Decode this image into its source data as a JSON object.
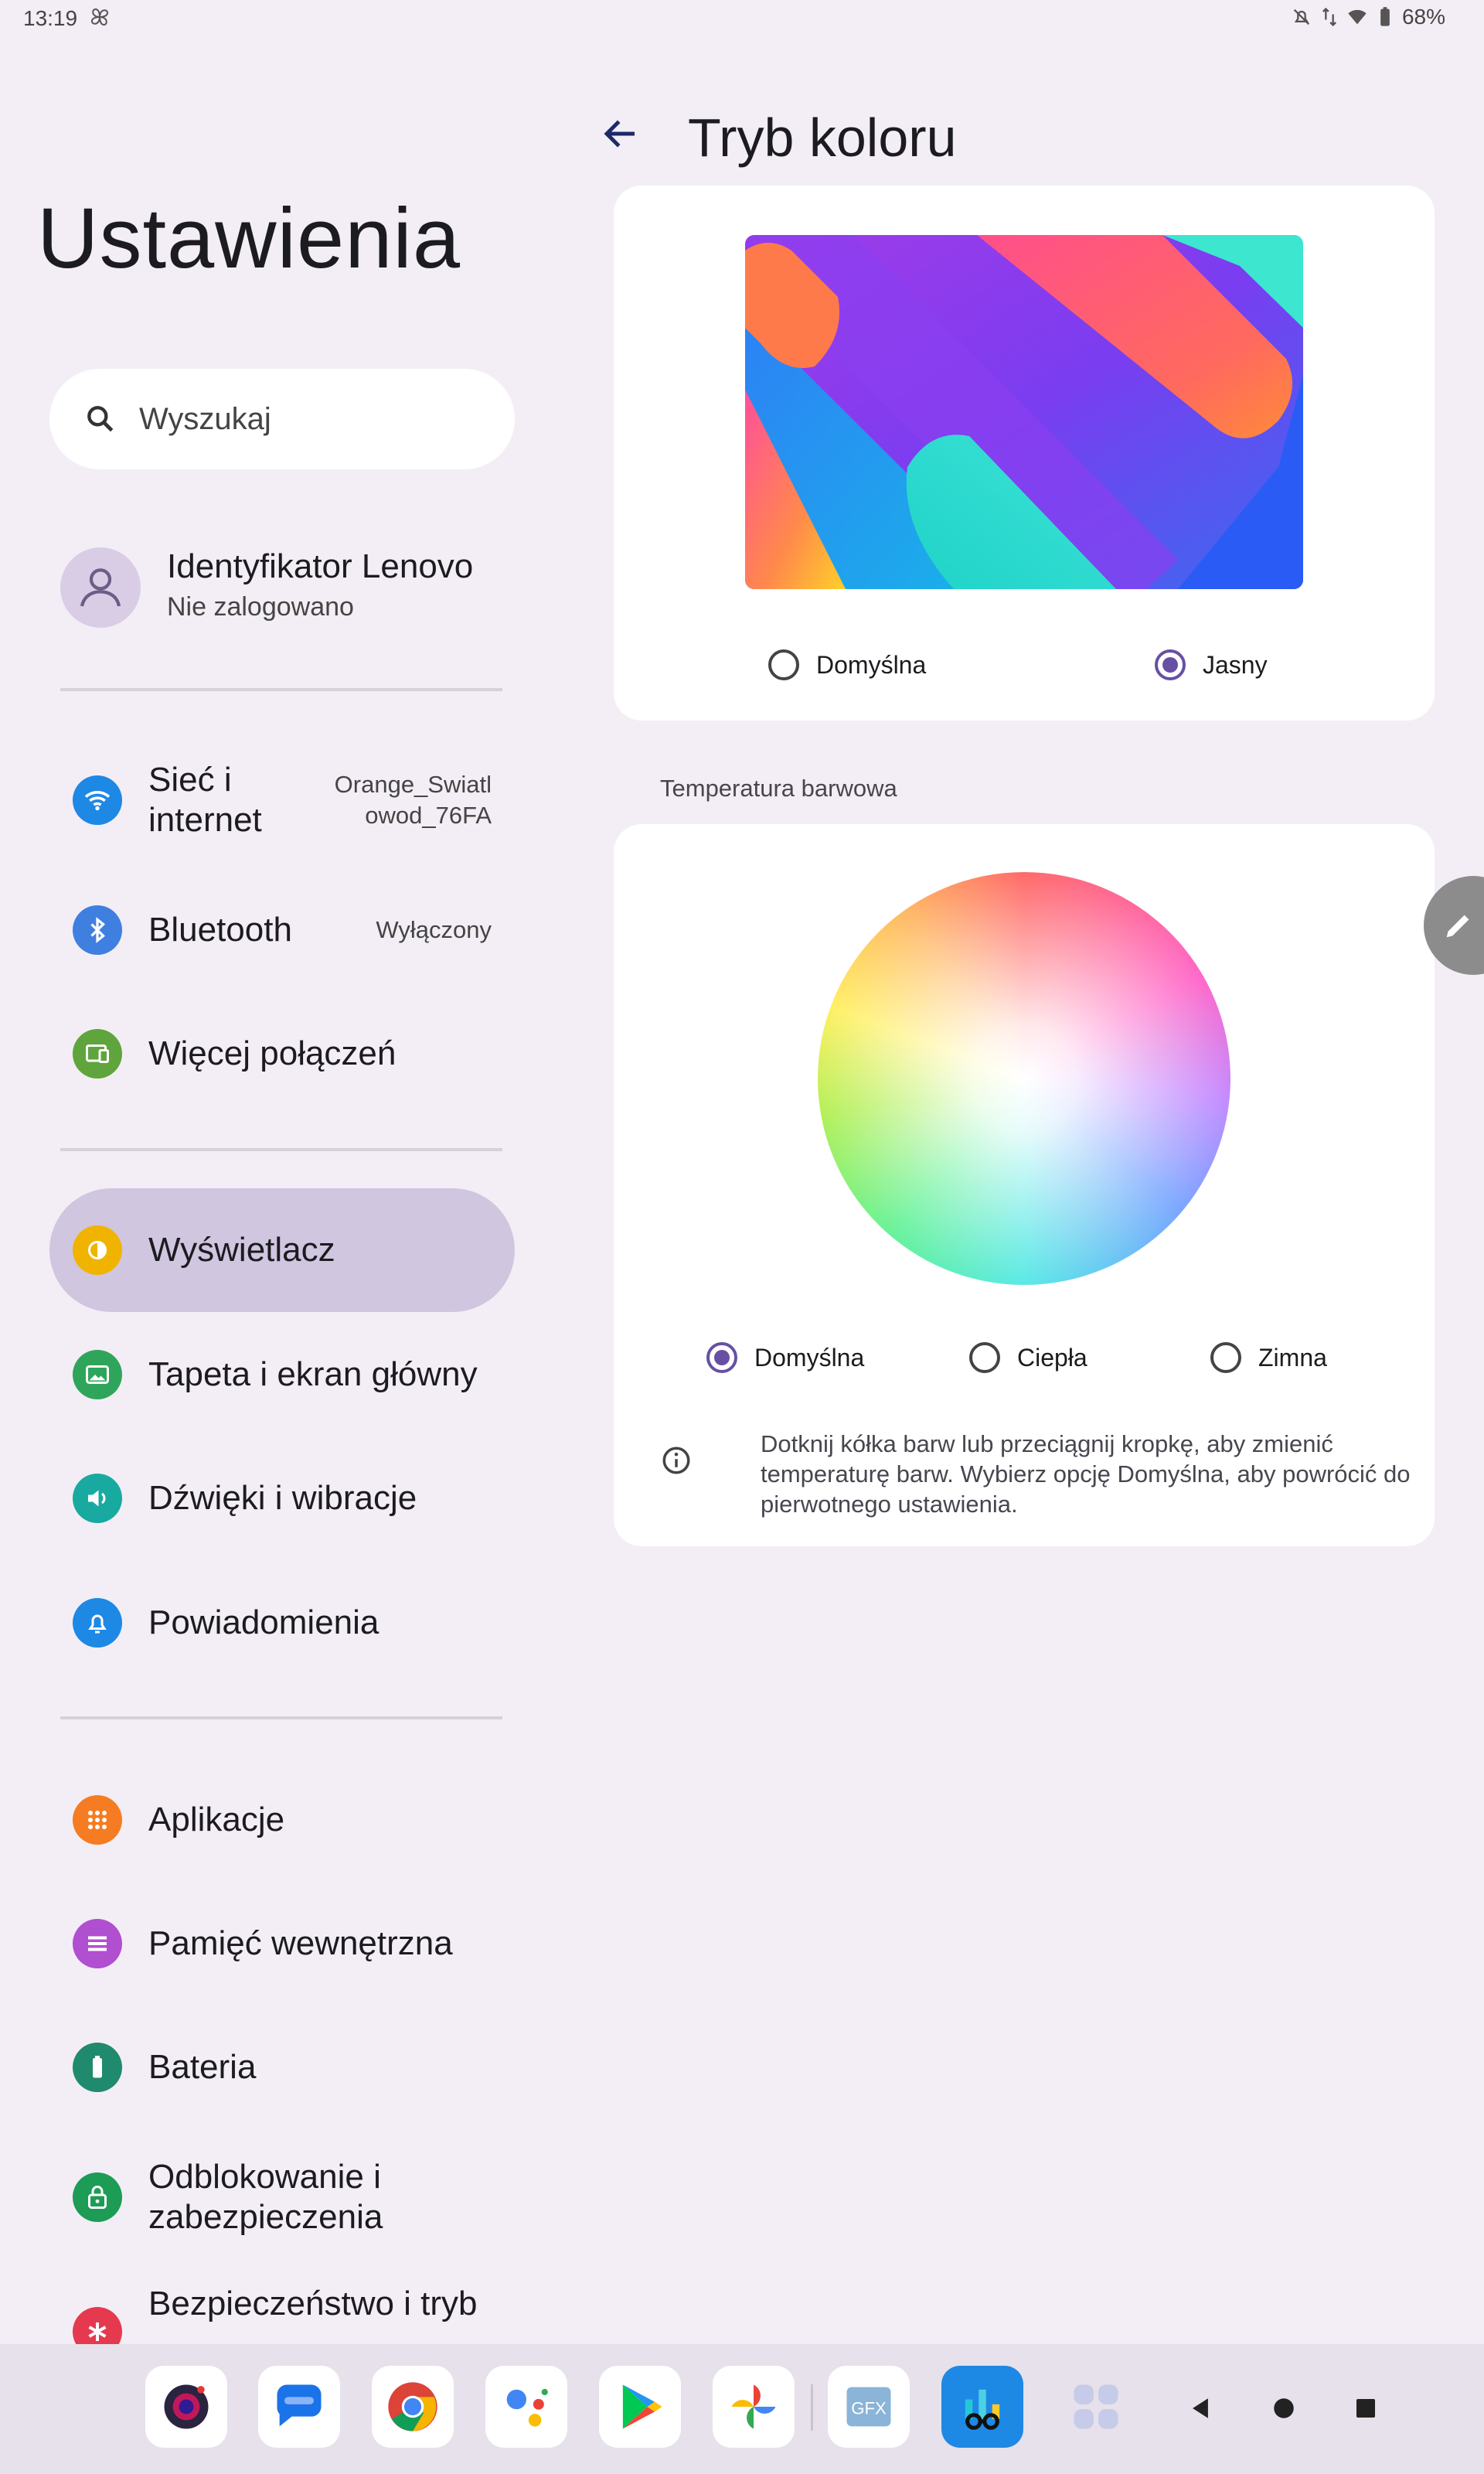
{
  "status_bar": {
    "time": "13:19",
    "battery": "68%"
  },
  "left_pane": {
    "title": "Ustawienia",
    "search": {
      "placeholder": "Wyszukaj"
    },
    "account": {
      "title": "Identyfikator Lenovo",
      "subtitle": "Nie zalogowano"
    },
    "groups": [
      [
        {
          "label_line1": "Sieć i",
          "label_line2": "internet",
          "value_line1": "Orange_Swiatl",
          "value_line2": "owod_76FA",
          "icon": "wifi-icon",
          "color": "#1e88e5"
        },
        {
          "label": "Bluetooth",
          "value": "Wyłączony",
          "icon": "bluetooth-icon",
          "color": "#3f7fe0"
        },
        {
          "label": "Więcej połączeń",
          "icon": "devices-icon",
          "color": "#5fa43c"
        }
      ],
      [
        {
          "label": "Wyświetlacz",
          "icon": "brightness-icon",
          "color": "#f0b400",
          "selected": true
        },
        {
          "label": "Tapeta i ekran główny",
          "icon": "wallpaper-icon",
          "color": "#2fa55b"
        },
        {
          "label": "Dźwięki i wibracje",
          "icon": "volume-icon",
          "color": "#18aaa0"
        },
        {
          "label": "Powiadomienia",
          "icon": "bell-icon",
          "color": "#1e88e5"
        }
      ],
      [
        {
          "label": "Aplikacje",
          "icon": "apps-grid-icon",
          "color": "#f57c22"
        },
        {
          "label": "Pamięć wewnętrzna",
          "icon": "storage-icon",
          "color": "#b04fcf"
        },
        {
          "label": "Bateria",
          "icon": "battery-icon",
          "color": "#1f8a6e"
        },
        {
          "label_line1": "Odblokowanie i",
          "label_line2": "zabezpieczenia",
          "icon": "lock-icon",
          "color": "#1c9c55"
        },
        {
          "label_line1": "Bezpieczeństwo i tryb",
          "icon": "asterisk-icon",
          "color": "#e53950"
        }
      ]
    ]
  },
  "right_pane": {
    "back_icon": "arrow-back-icon",
    "title": "Tryb koloru",
    "color_mode_options": [
      {
        "label": "Domyślna",
        "selected": false
      },
      {
        "label": "Jasny",
        "selected": true
      }
    ],
    "temperature_section_label": "Temperatura barwowa",
    "temperature_options": [
      {
        "label": "Domyślna",
        "selected": true
      },
      {
        "label": "Ciepła",
        "selected": false
      },
      {
        "label": "Zimna",
        "selected": false
      }
    ],
    "info_text": "Dotknij kółka barw lub przeciągnij kropkę, aby zmienić temperaturę barw. Wybierz opcję Domyślna, aby powrócić do pierwotnego ustawienia."
  },
  "taskbar": {
    "apps": [
      "camera-app-icon",
      "messages-app-icon",
      "chrome-app-icon",
      "assistant-app-icon",
      "play-store-app-icon",
      "photos-app-icon",
      "gfx-app-icon",
      "geekbench-app-icon",
      "app-drawer-icon"
    ],
    "gfx_label": "GFX",
    "nav": [
      "back-nav-icon",
      "home-nav-icon",
      "recents-nav-icon"
    ]
  },
  "colors": {
    "accent": "#6750a4",
    "selected_bg": "#d0c6e0",
    "background": "#f3eef5"
  }
}
